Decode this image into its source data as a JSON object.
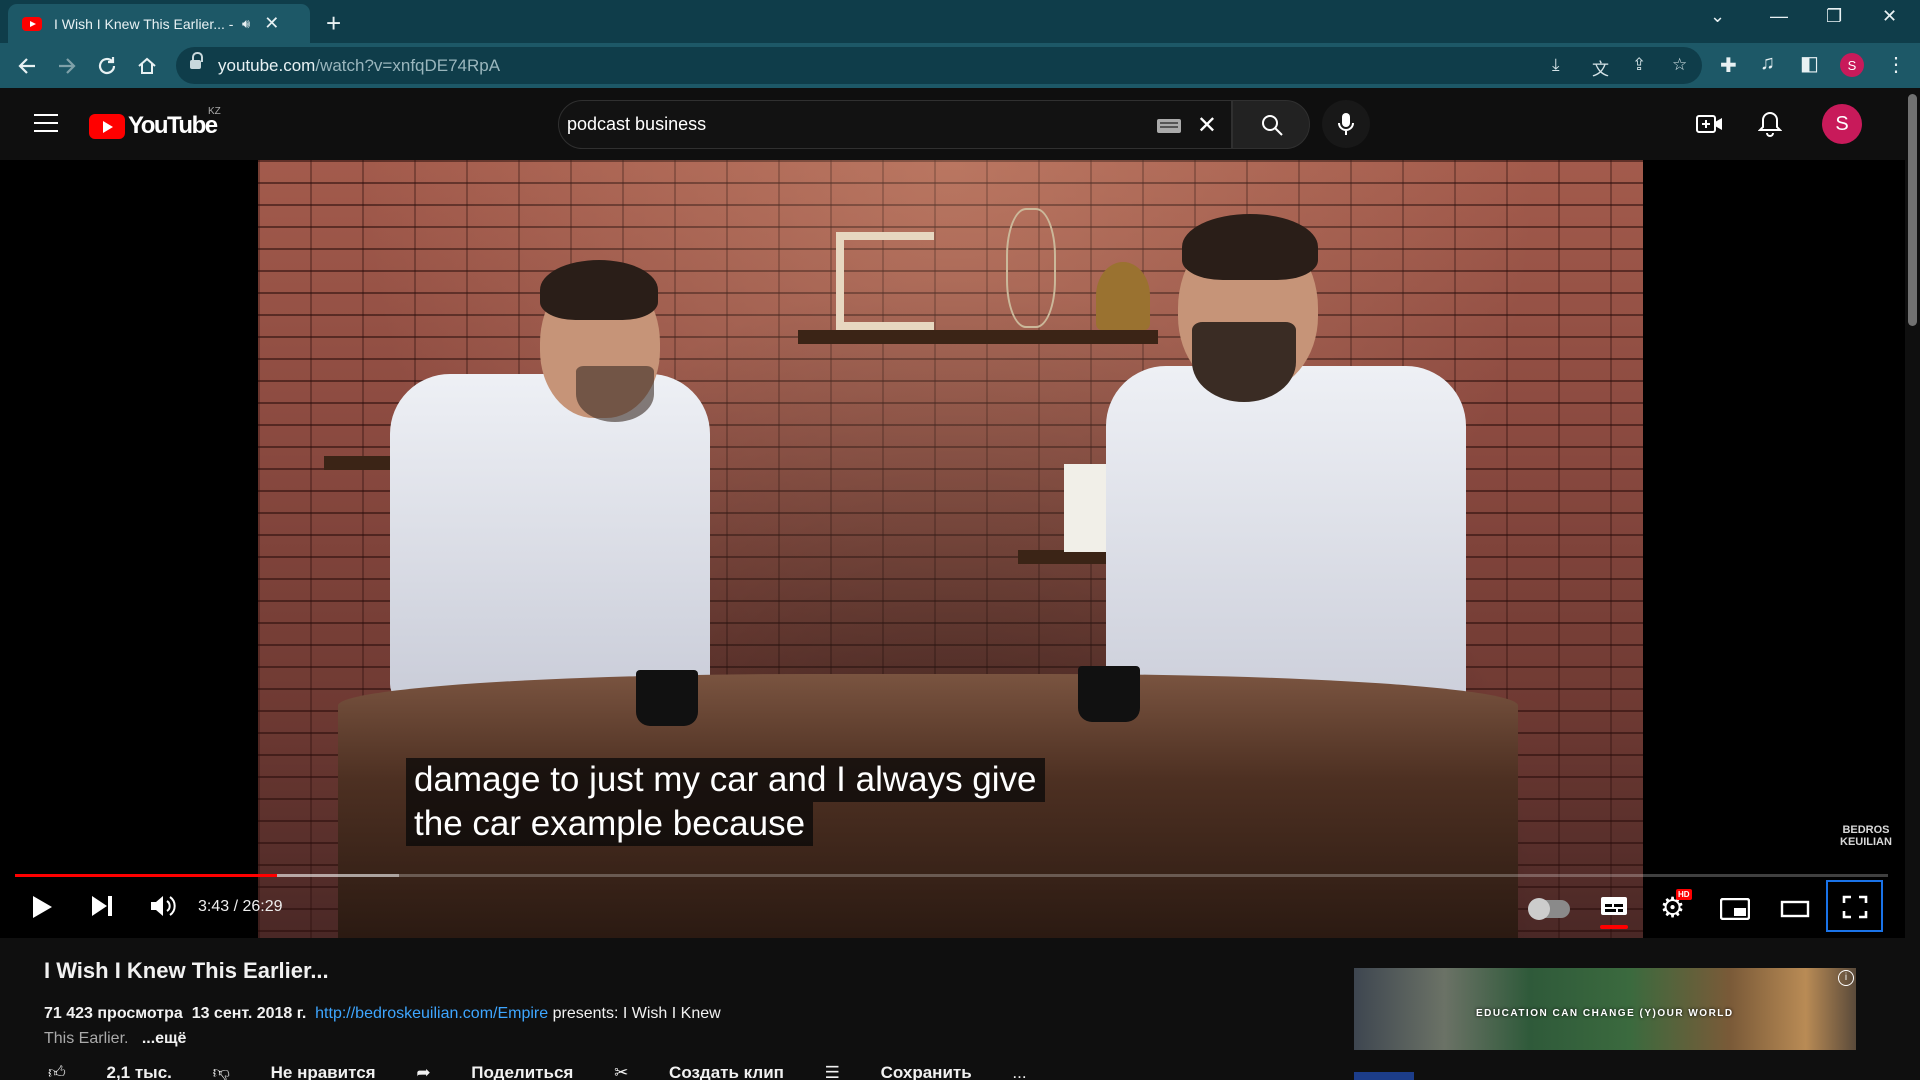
{
  "browser": {
    "tab_title": "I Wish I Knew This Earlier... - YouTube",
    "new_tab_label": "+",
    "url_host": "youtube.com",
    "url_path": "/watch?v=xnfqDE74RpA",
    "profile_initial": "S"
  },
  "masthead": {
    "logo_text": "YouTube",
    "country_code": "KZ",
    "search_query": "podcast business",
    "profile_initial": "S"
  },
  "player": {
    "caption_lines": [
      "damage to just my car and I always give",
      "the car example because"
    ],
    "watermark": [
      "BEDROS",
      "KEUILIAN"
    ],
    "time_text": "3:43 / 26:29",
    "progress": {
      "played_fraction": 0.14,
      "buffered_fraction": 0.205
    },
    "settings_badge": "HD"
  },
  "video": {
    "title": "I Wish I Knew This Earlier...",
    "views": "71 423 просмотра",
    "date": "13 сент. 2018 г.",
    "link": "http://bedroskeuilian.com/Empire",
    "desc_inline": " presents: I Wish I Knew",
    "desc_second": "This Earlier.",
    "more_label": "...ещё"
  },
  "actions": {
    "like": "2,1 тыс.",
    "dislike": "Не нравится",
    "share": "Поделиться",
    "clip": "Создать клип",
    "save": "Сохранить",
    "more": "..."
  },
  "ad": {
    "text": "EDUCATION CAN CHANGE (Y)OUR WORLD",
    "info": "i"
  },
  "colors": {
    "brand_red": "#ff0000",
    "chrome_dark": "#0f3d4a",
    "chrome_light": "#1d5867",
    "link_blue": "#3ea6ff",
    "focus_blue": "#1a73e8",
    "avatar_pink": "#c81a5a"
  }
}
